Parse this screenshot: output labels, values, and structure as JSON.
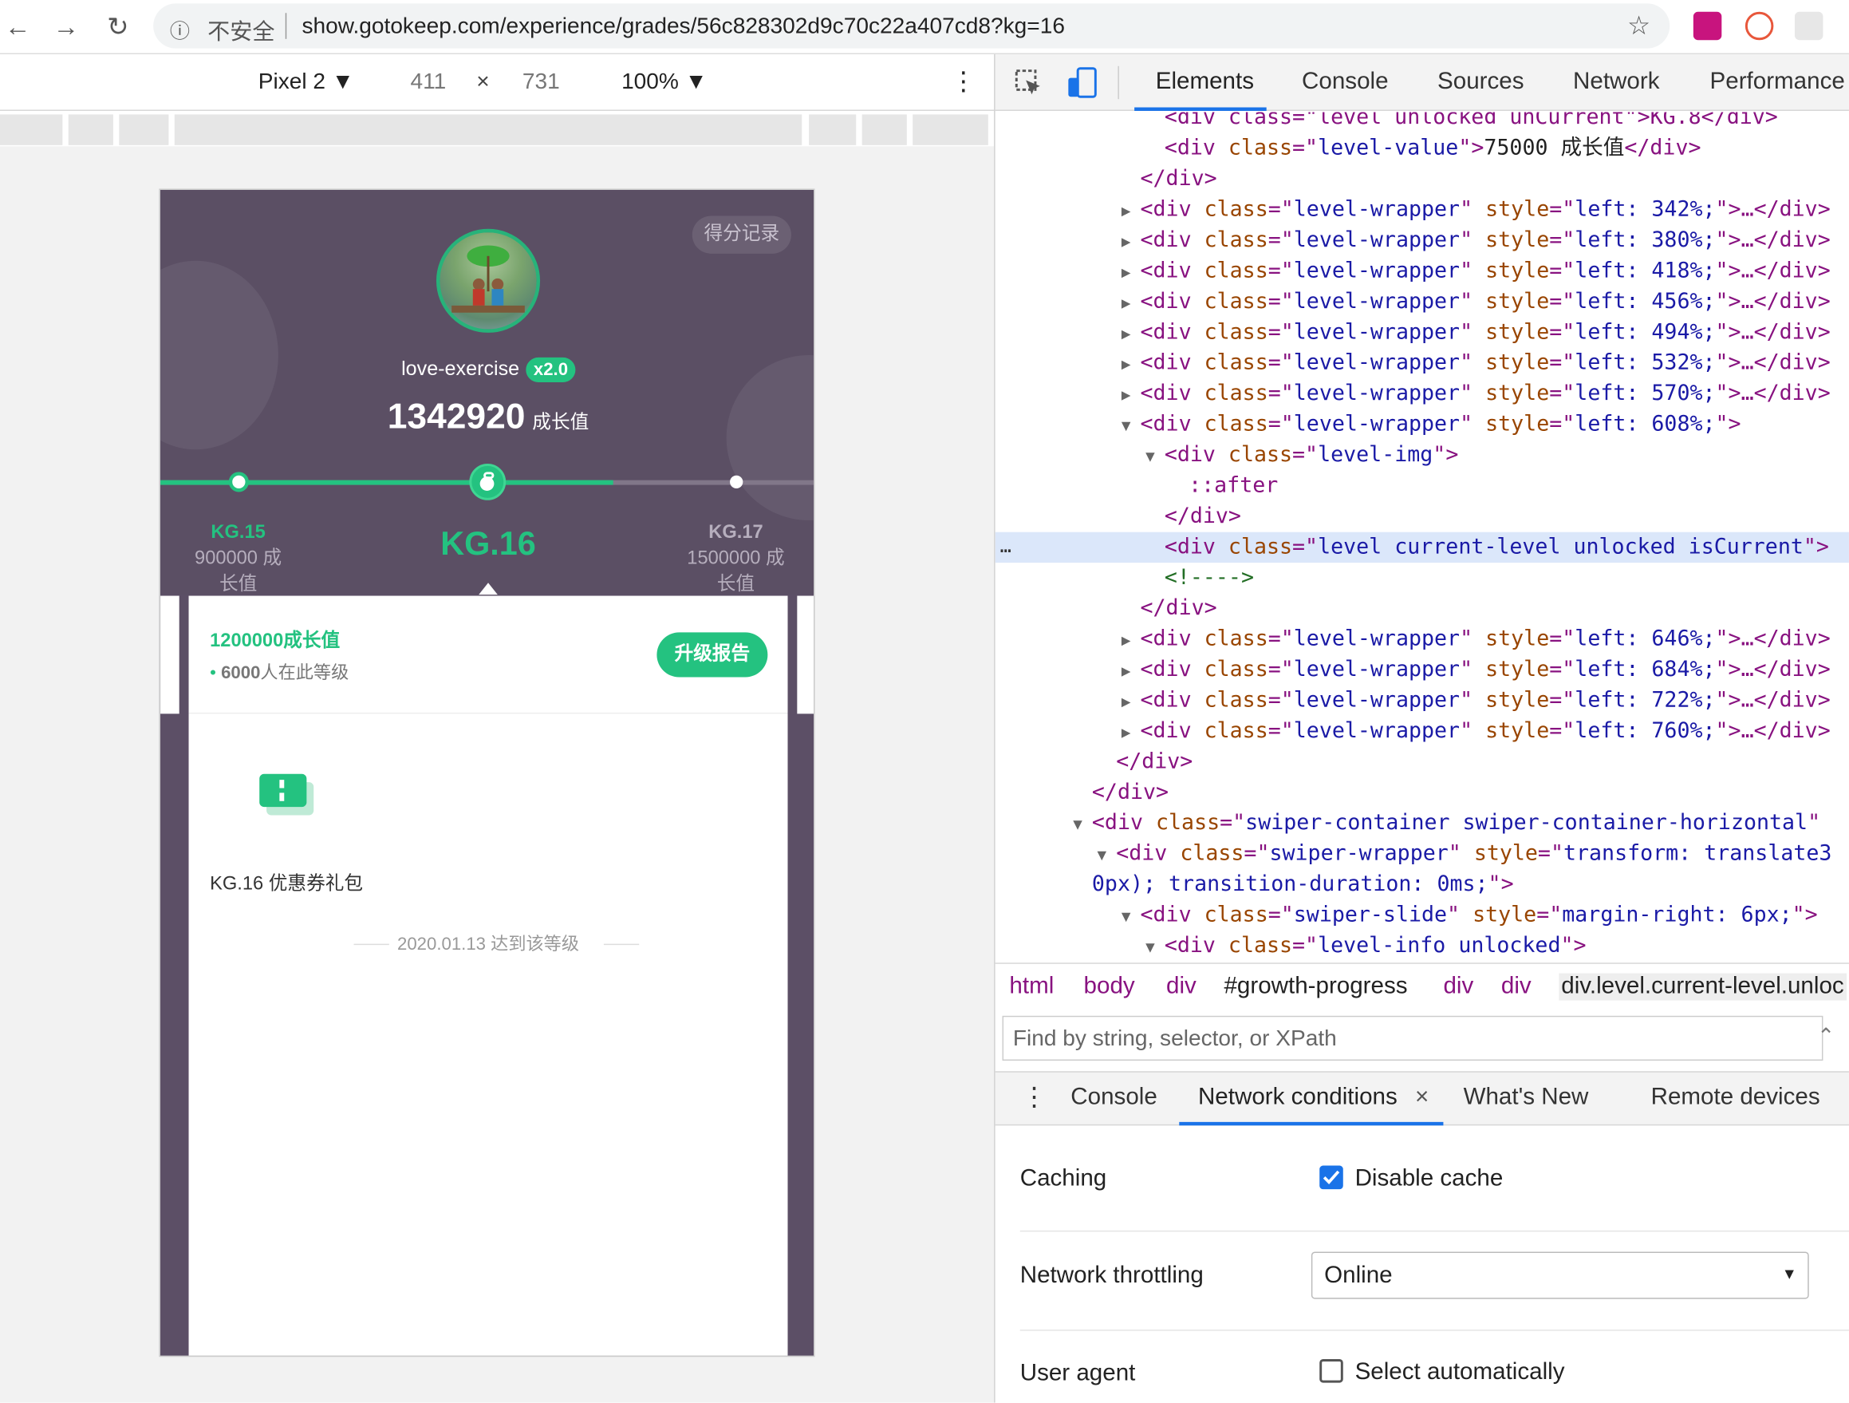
{
  "browser": {
    "url_warning": "不安全",
    "url": "show.gotokeep.com/experience/grades/56c828302d9c70c22a407cd8?kg=16"
  },
  "device_toolbar": {
    "device": "Pixel 2",
    "width": "411",
    "times": "×",
    "height": "731",
    "zoom": "100%"
  },
  "page": {
    "record_button": "得分记录",
    "username": "love-exercise",
    "multiplier": "x2.0",
    "score": "1342920",
    "score_unit": "成长值",
    "progress_fraction": 0.69,
    "levels": {
      "prev": {
        "name": "KG.15",
        "value_line1": "900000 成",
        "value_line2": "长值"
      },
      "current": {
        "name": "KG.16"
      },
      "next": {
        "name": "KG.17",
        "value_line1": "1500000 成",
        "value_line2": "长值"
      }
    },
    "card": {
      "growth_value": "1200000成长值",
      "people_count": "6000",
      "people_suffix": "人在此等级",
      "upgrade_button": "升级报告",
      "reward_label": "KG.16 优惠券礼包",
      "reached_date": "2020.01.13 达到该等级"
    }
  },
  "devtools": {
    "tabs": [
      "Elements",
      "Console",
      "Sources",
      "Network",
      "Performance"
    ],
    "breadcrumbs": [
      "html",
      "body",
      "div",
      "#growth-progress",
      "div",
      "div",
      "div.level.current-level.unloc"
    ],
    "find_placeholder": "Find by string, selector, or XPath",
    "drawer_tabs": [
      "Console",
      "Network conditions",
      "What's New",
      "Remote devices"
    ],
    "drawer_close": "×",
    "network_conditions": {
      "caching_label": "Caching",
      "disable_cache_label": "Disable cache",
      "disable_cache_checked": true,
      "throttling_label": "Network throttling",
      "throttling_value": "Online",
      "user_agent_label": "User agent",
      "select_auto_label": "Select automatically",
      "select_auto_checked": false
    },
    "code_lines": [
      {
        "indent": 7,
        "html": "&lt;div class=\"level unlocked unCurrent\"&gt;KG.8&lt;/div&gt;"
      },
      {
        "indent": 7,
        "parts": [
          [
            "tag",
            "<div "
          ],
          [
            "an",
            "class"
          ],
          [
            "tag",
            "=\""
          ],
          [
            "av",
            "level-value"
          ],
          [
            "tag",
            "\">"
          ],
          [
            "tx",
            "75000 成长值"
          ],
          [
            "tag",
            "</div>"
          ]
        ]
      },
      {
        "indent": 6,
        "parts": [
          [
            "tag",
            "</div>"
          ]
        ]
      },
      {
        "indent": 6,
        "tri": "▶",
        "parts": [
          [
            "tag",
            "<div "
          ],
          [
            "an",
            "class"
          ],
          [
            "tag",
            "=\""
          ],
          [
            "av",
            "level-wrapper"
          ],
          [
            "tag",
            "\" "
          ],
          [
            "an",
            "style"
          ],
          [
            "tag",
            "=\""
          ],
          [
            "av",
            "left: 342%;"
          ],
          [
            "tag",
            "\">…</div>"
          ]
        ]
      },
      {
        "indent": 6,
        "tri": "▶",
        "parts": [
          [
            "tag",
            "<div "
          ],
          [
            "an",
            "class"
          ],
          [
            "tag",
            "=\""
          ],
          [
            "av",
            "level-wrapper"
          ],
          [
            "tag",
            "\" "
          ],
          [
            "an",
            "style"
          ],
          [
            "tag",
            "=\""
          ],
          [
            "av",
            "left: 380%;"
          ],
          [
            "tag",
            "\">…</div>"
          ]
        ]
      },
      {
        "indent": 6,
        "tri": "▶",
        "parts": [
          [
            "tag",
            "<div "
          ],
          [
            "an",
            "class"
          ],
          [
            "tag",
            "=\""
          ],
          [
            "av",
            "level-wrapper"
          ],
          [
            "tag",
            "\" "
          ],
          [
            "an",
            "style"
          ],
          [
            "tag",
            "=\""
          ],
          [
            "av",
            "left: 418%;"
          ],
          [
            "tag",
            "\">…</div>"
          ]
        ]
      },
      {
        "indent": 6,
        "tri": "▶",
        "parts": [
          [
            "tag",
            "<div "
          ],
          [
            "an",
            "class"
          ],
          [
            "tag",
            "=\""
          ],
          [
            "av",
            "level-wrapper"
          ],
          [
            "tag",
            "\" "
          ],
          [
            "an",
            "style"
          ],
          [
            "tag",
            "=\""
          ],
          [
            "av",
            "left: 456%;"
          ],
          [
            "tag",
            "\">…</div>"
          ]
        ]
      },
      {
        "indent": 6,
        "tri": "▶",
        "parts": [
          [
            "tag",
            "<div "
          ],
          [
            "an",
            "class"
          ],
          [
            "tag",
            "=\""
          ],
          [
            "av",
            "level-wrapper"
          ],
          [
            "tag",
            "\" "
          ],
          [
            "an",
            "style"
          ],
          [
            "tag",
            "=\""
          ],
          [
            "av",
            "left: 494%;"
          ],
          [
            "tag",
            "\">…</div>"
          ]
        ]
      },
      {
        "indent": 6,
        "tri": "▶",
        "parts": [
          [
            "tag",
            "<div "
          ],
          [
            "an",
            "class"
          ],
          [
            "tag",
            "=\""
          ],
          [
            "av",
            "level-wrapper"
          ],
          [
            "tag",
            "\" "
          ],
          [
            "an",
            "style"
          ],
          [
            "tag",
            "=\""
          ],
          [
            "av",
            "left: 532%;"
          ],
          [
            "tag",
            "\">…</div>"
          ]
        ]
      },
      {
        "indent": 6,
        "tri": "▶",
        "parts": [
          [
            "tag",
            "<div "
          ],
          [
            "an",
            "class"
          ],
          [
            "tag",
            "=\""
          ],
          [
            "av",
            "level-wrapper"
          ],
          [
            "tag",
            "\" "
          ],
          [
            "an",
            "style"
          ],
          [
            "tag",
            "=\""
          ],
          [
            "av",
            "left: 570%;"
          ],
          [
            "tag",
            "\">…</div>"
          ]
        ]
      },
      {
        "indent": 6,
        "tri": "▼",
        "parts": [
          [
            "tag",
            "<div "
          ],
          [
            "an",
            "class"
          ],
          [
            "tag",
            "=\""
          ],
          [
            "av",
            "level-wrapper"
          ],
          [
            "tag",
            "\" "
          ],
          [
            "an",
            "style"
          ],
          [
            "tag",
            "=\""
          ],
          [
            "av",
            "left: 608%;"
          ],
          [
            "tag",
            "\">"
          ]
        ]
      },
      {
        "indent": 7,
        "tri": "▼",
        "parts": [
          [
            "tag",
            "<div "
          ],
          [
            "an",
            "class"
          ],
          [
            "tag",
            "=\""
          ],
          [
            "av",
            "level-img"
          ],
          [
            "tag",
            "\">"
          ]
        ]
      },
      {
        "indent": 8,
        "parts": [
          [
            "tag",
            "::after"
          ]
        ]
      },
      {
        "indent": 7,
        "parts": [
          [
            "tag",
            "</div>"
          ]
        ]
      },
      {
        "indent": 7,
        "selected": true,
        "parts": [
          [
            "tag",
            "<div "
          ],
          [
            "an",
            "class"
          ],
          [
            "tag",
            "=\""
          ],
          [
            "av",
            "level current-level unlocked isCurrent"
          ],
          [
            "tag",
            "\">"
          ]
        ]
      },
      {
        "indent": 7,
        "parts": [
          [
            "cm",
            "<!---->"
          ]
        ]
      },
      {
        "indent": 6,
        "parts": [
          [
            "tag",
            "</div>"
          ]
        ]
      },
      {
        "indent": 6,
        "tri": "▶",
        "parts": [
          [
            "tag",
            "<div "
          ],
          [
            "an",
            "class"
          ],
          [
            "tag",
            "=\""
          ],
          [
            "av",
            "level-wrapper"
          ],
          [
            "tag",
            "\" "
          ],
          [
            "an",
            "style"
          ],
          [
            "tag",
            "=\""
          ],
          [
            "av",
            "left: 646%;"
          ],
          [
            "tag",
            "\">…</div>"
          ]
        ]
      },
      {
        "indent": 6,
        "tri": "▶",
        "parts": [
          [
            "tag",
            "<div "
          ],
          [
            "an",
            "class"
          ],
          [
            "tag",
            "=\""
          ],
          [
            "av",
            "level-wrapper"
          ],
          [
            "tag",
            "\" "
          ],
          [
            "an",
            "style"
          ],
          [
            "tag",
            "=\""
          ],
          [
            "av",
            "left: 684%;"
          ],
          [
            "tag",
            "\">…</div>"
          ]
        ]
      },
      {
        "indent": 6,
        "tri": "▶",
        "parts": [
          [
            "tag",
            "<div "
          ],
          [
            "an",
            "class"
          ],
          [
            "tag",
            "=\""
          ],
          [
            "av",
            "level-wrapper"
          ],
          [
            "tag",
            "\" "
          ],
          [
            "an",
            "style"
          ],
          [
            "tag",
            "=\""
          ],
          [
            "av",
            "left: 722%;"
          ],
          [
            "tag",
            "\">…</div>"
          ]
        ]
      },
      {
        "indent": 6,
        "tri": "▶",
        "parts": [
          [
            "tag",
            "<div "
          ],
          [
            "an",
            "class"
          ],
          [
            "tag",
            "=\""
          ],
          [
            "av",
            "level-wrapper"
          ],
          [
            "tag",
            "\" "
          ],
          [
            "an",
            "style"
          ],
          [
            "tag",
            "=\""
          ],
          [
            "av",
            "left: 760%;"
          ],
          [
            "tag",
            "\">…</div>"
          ]
        ]
      },
      {
        "indent": 5,
        "parts": [
          [
            "tag",
            "</div>"
          ]
        ]
      },
      {
        "indent": 4,
        "parts": [
          [
            "tag",
            "</div>"
          ]
        ]
      },
      {
        "indent": 4,
        "tri": "▼",
        "parts": [
          [
            "tag",
            "<div "
          ],
          [
            "an",
            "class"
          ],
          [
            "tag",
            "=\""
          ],
          [
            "av",
            "swiper-container swiper-container-horizontal"
          ],
          [
            "tag",
            "\""
          ]
        ]
      },
      {
        "indent": 5,
        "tri": "▼",
        "parts": [
          [
            "tag",
            "<div "
          ],
          [
            "an",
            "class"
          ],
          [
            "tag",
            "=\""
          ],
          [
            "av",
            "swiper-wrapper"
          ],
          [
            "tag",
            "\" "
          ],
          [
            "an",
            "style"
          ],
          [
            "tag",
            "=\""
          ],
          [
            "av",
            "transform: translate3"
          ]
        ]
      },
      {
        "indent": 4,
        "parts": [
          [
            "av",
            "0px); transition-duration: 0ms;"
          ],
          [
            "tag",
            "\">"
          ]
        ]
      },
      {
        "indent": 6,
        "tri": "▼",
        "parts": [
          [
            "tag",
            "<div "
          ],
          [
            "an",
            "class"
          ],
          [
            "tag",
            "=\""
          ],
          [
            "av",
            "swiper-slide"
          ],
          [
            "tag",
            "\" "
          ],
          [
            "an",
            "style"
          ],
          [
            "tag",
            "=\""
          ],
          [
            "av",
            "margin-right: 6px;"
          ],
          [
            "tag",
            "\">"
          ]
        ]
      },
      {
        "indent": 7,
        "tri": "▼",
        "parts": [
          [
            "tag",
            "<div "
          ],
          [
            "an",
            "class"
          ],
          [
            "tag",
            "=\""
          ],
          [
            "av",
            "level-info unlocked"
          ],
          [
            "tag",
            "\">"
          ]
        ]
      }
    ]
  },
  "colors": {
    "accent": "#24c280",
    "header_bg": "#5b4f64",
    "devtools_selected": "#dbe7fa"
  }
}
